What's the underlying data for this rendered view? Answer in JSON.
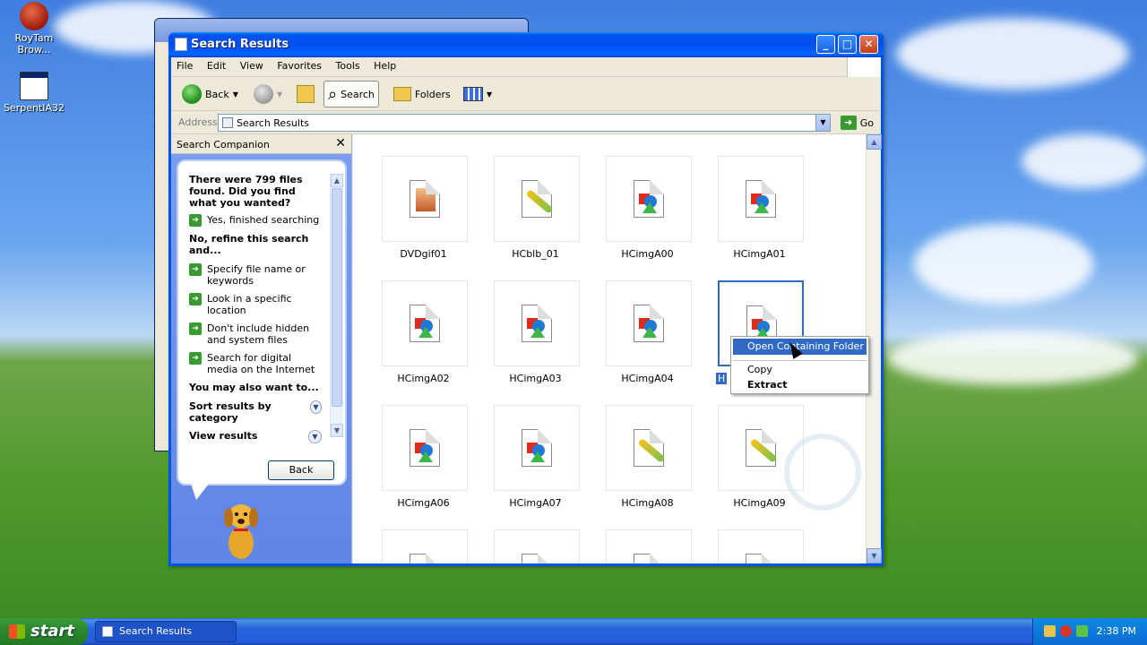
{
  "desktop": {
    "icons": [
      {
        "label": "RoyTam Brow..."
      },
      {
        "label": "SerpentIA32"
      }
    ]
  },
  "window": {
    "title": "Search Results"
  },
  "menubar": {
    "items": [
      "File",
      "Edit",
      "View",
      "Favorites",
      "Tools",
      "Help"
    ]
  },
  "toolbar": {
    "back_label": "Back",
    "search_label": "Search",
    "folders_label": "Folders"
  },
  "address": {
    "label": "Address",
    "value": "Search Results",
    "go_label": "Go"
  },
  "companion": {
    "title": "Search Companion",
    "question": "There were 799 files found. Did you find what you wanted?",
    "yes_option": "Yes, finished searching",
    "refine_heading": "No, refine this search and...",
    "refine_options": [
      "Specify file name or keywords",
      "Look in a specific location",
      "Don't include hidden and system files",
      "Search for digital media on the Internet"
    ],
    "also_heading": "You may also want to...",
    "sort_label": "Sort results by category",
    "view_label": "View results",
    "back_button": "Back"
  },
  "results": {
    "files": [
      {
        "name": "DVDgif01",
        "kind": "photo"
      },
      {
        "name": "HCblb_01",
        "kind": "brush"
      },
      {
        "name": "HCimgA00",
        "kind": "shapes"
      },
      {
        "name": "HCimgA01",
        "kind": "shapes"
      },
      {
        "name": "HCimgA02",
        "kind": "shapes"
      },
      {
        "name": "HCimgA03",
        "kind": "shapes"
      },
      {
        "name": "HCimgA04",
        "kind": "shapes"
      },
      {
        "name": "H",
        "kind": "shapes",
        "selected": true
      },
      {
        "name": "HCimgA06",
        "kind": "shapes"
      },
      {
        "name": "HCimgA07",
        "kind": "shapes"
      },
      {
        "name": "HCimgA08",
        "kind": "brush"
      },
      {
        "name": "HCimgA09",
        "kind": "brush"
      }
    ]
  },
  "context_menu": {
    "items": [
      "Open Containing Folder",
      "Copy",
      "Extract"
    ]
  },
  "taskbar": {
    "start_label": "start",
    "task_label": "Search Results",
    "clock": "2:38 PM"
  }
}
